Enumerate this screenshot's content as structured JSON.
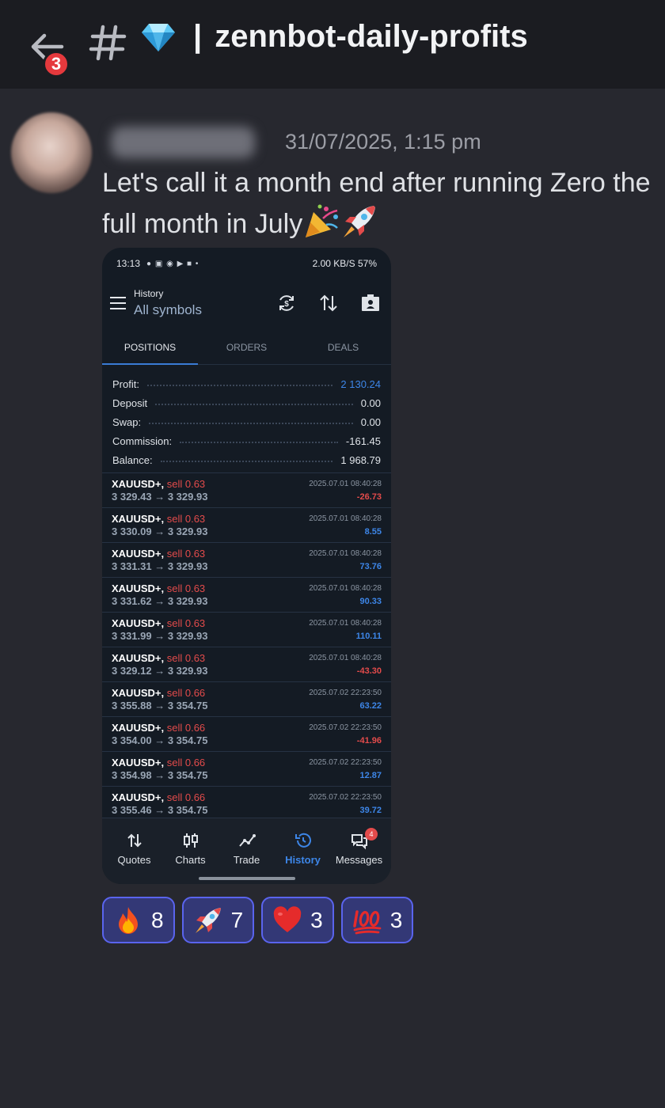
{
  "header": {
    "back_badge": "3",
    "channel_emoji": "gem-icon",
    "separator": "|",
    "channel_name": "zennbot-daily-profits"
  },
  "message": {
    "timestamp": "31/07/2025, 1:15 pm",
    "text": "Let's call it a month end after running Zero the full month in July"
  },
  "phone": {
    "status_time": "13:13",
    "status_right": "2.00 KB/S  57%",
    "title_small": "History",
    "title_main": "All symbols",
    "tabs": [
      "POSITIONS",
      "ORDERS",
      "DEALS"
    ],
    "summary": [
      {
        "label": "Profit:",
        "value": "2 130.24"
      },
      {
        "label": "Deposit",
        "value": "0.00"
      },
      {
        "label": "Swap:",
        "value": "0.00"
      },
      {
        "label": "Commission:",
        "value": "-161.45"
      },
      {
        "label": "Balance:",
        "value": "1 968.79"
      }
    ],
    "trades": [
      {
        "symbol": "XAUUSD+,",
        "side": "sell 0.63",
        "prices": "3 329.43 → 3 329.93",
        "date": "2025.07.01 08:40:28",
        "pl": "-26.73"
      },
      {
        "symbol": "XAUUSD+,",
        "side": "sell 0.63",
        "prices": "3 330.09 → 3 329.93",
        "date": "2025.07.01 08:40:28",
        "pl": "8.55"
      },
      {
        "symbol": "XAUUSD+,",
        "side": "sell 0.63",
        "prices": "3 331.31 → 3 329.93",
        "date": "2025.07.01 08:40:28",
        "pl": "73.76"
      },
      {
        "symbol": "XAUUSD+,",
        "side": "sell 0.63",
        "prices": "3 331.62 → 3 329.93",
        "date": "2025.07.01 08:40:28",
        "pl": "90.33"
      },
      {
        "symbol": "XAUUSD+,",
        "side": "sell 0.63",
        "prices": "3 331.99 → 3 329.93",
        "date": "2025.07.01 08:40:28",
        "pl": "110.11"
      },
      {
        "symbol": "XAUUSD+,",
        "side": "sell 0.63",
        "prices": "3 329.12 → 3 329.93",
        "date": "2025.07.01 08:40:28",
        "pl": "-43.30"
      },
      {
        "symbol": "XAUUSD+,",
        "side": "sell 0.66",
        "prices": "3 355.88 → 3 354.75",
        "date": "2025.07.02 22:23:50",
        "pl": "63.22"
      },
      {
        "symbol": "XAUUSD+,",
        "side": "sell 0.66",
        "prices": "3 354.00 → 3 354.75",
        "date": "2025.07.02 22:23:50",
        "pl": "-41.96"
      },
      {
        "symbol": "XAUUSD+,",
        "side": "sell 0.66",
        "prices": "3 354.98 → 3 354.75",
        "date": "2025.07.02 22:23:50",
        "pl": "12.87"
      },
      {
        "symbol": "XAUUSD+,",
        "side": "sell 0.66",
        "prices": "3 355.46 → 3 354.75",
        "date": "2025.07.02 22:23:50",
        "pl": "39.72"
      }
    ],
    "nav": [
      "Quotes",
      "Charts",
      "Trade",
      "History",
      "Messages"
    ],
    "messages_badge": "4"
  },
  "reactions": [
    {
      "emoji": "fire-icon",
      "count": "8"
    },
    {
      "emoji": "rocket-icon",
      "count": "7"
    },
    {
      "emoji": "heart-icon",
      "count": "3"
    },
    {
      "emoji": "hundred-points-icon",
      "count": "3"
    }
  ],
  "colors": {
    "background": "#27282f",
    "header": "#1b1c21",
    "badge": "#e5393d",
    "reaction_bg": "#333876",
    "reaction_border": "#5a64ee",
    "profit_blue": "#3d86e8",
    "loss_red": "#e34b4b"
  }
}
